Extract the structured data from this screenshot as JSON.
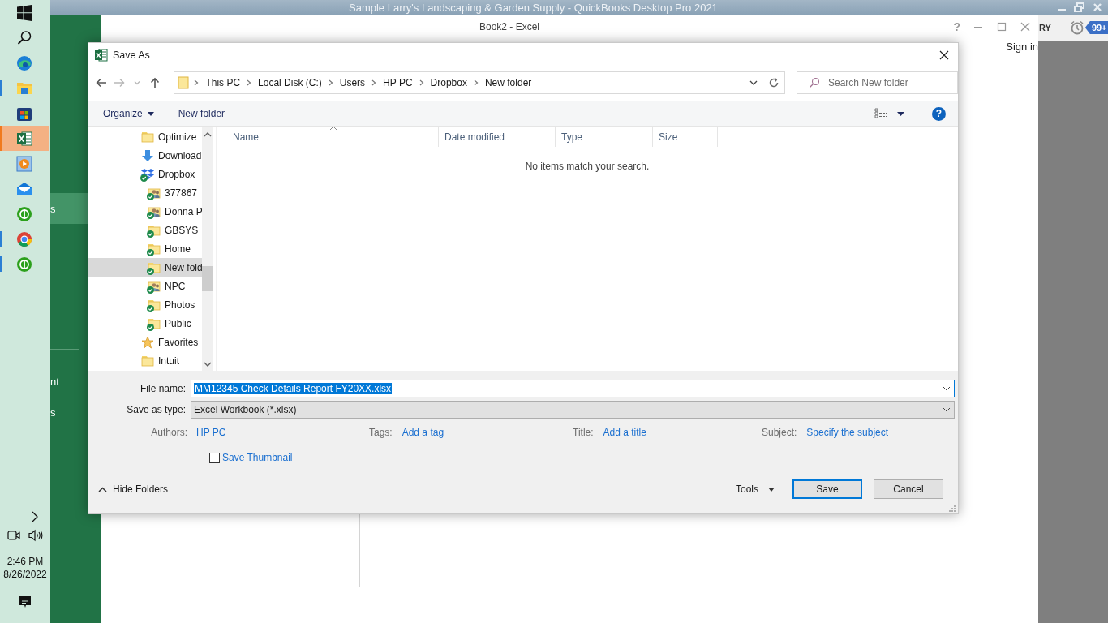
{
  "quickbooks": {
    "title": "Sample Larry's Landscaping & Garden Supply - QuickBooks Desktop Pro 2021",
    "tab_fragment": "RY",
    "reminder_count": "99+"
  },
  "excel": {
    "title": "Book2 - Excel",
    "help": "?",
    "sign_in": "Sign in",
    "backstage_items": [
      {
        "label": "s",
        "selected": true
      },
      {
        "label": "nt",
        "selected": false
      },
      {
        "label": "s",
        "selected": false
      }
    ]
  },
  "dialog": {
    "title": "Save As",
    "address_nav": [
      {
        "disabled": false
      },
      {
        "disabled": true
      },
      {
        "disabled": true
      },
      {
        "disabled": false
      }
    ],
    "breadcrumb": [
      "This PC",
      "Local Disk (C:)",
      "Users",
      "HP PC",
      "Dropbox",
      "New folder"
    ],
    "search": {
      "placeholder": "Search New folder"
    },
    "toolbar": {
      "organize": "Organize",
      "new_folder": "New folder",
      "help": "?"
    },
    "nav": [
      {
        "label": "Optimize",
        "kind": "folder",
        "synced": false,
        "selected": false
      },
      {
        "label": "Download",
        "kind": "download",
        "synced": false,
        "selected": false
      },
      {
        "label": "Dropbox",
        "kind": "dropbox",
        "synced": true,
        "selected": false,
        "children": [
          {
            "label": "377867",
            "kind": "shared",
            "synced": true,
            "selected": false
          },
          {
            "label": "Donna P",
            "kind": "shared",
            "synced": true,
            "selected": false
          },
          {
            "label": "GBSYS",
            "kind": "folder",
            "synced": true,
            "selected": false
          },
          {
            "label": "Home",
            "kind": "folder",
            "synced": true,
            "selected": false
          },
          {
            "label": "New fold",
            "kind": "folder",
            "synced": true,
            "selected": true
          },
          {
            "label": "NPC",
            "kind": "shared",
            "synced": true,
            "selected": false
          },
          {
            "label": "Photos",
            "kind": "folder",
            "synced": true,
            "selected": false
          },
          {
            "label": "Public",
            "kind": "folder",
            "synced": true,
            "selected": false
          }
        ]
      },
      {
        "label": "Favorites",
        "kind": "star",
        "synced": false,
        "selected": false
      },
      {
        "label": "Intuit",
        "kind": "folder",
        "synced": false,
        "selected": false
      }
    ],
    "columns": [
      {
        "label": "Name",
        "sorted": true
      },
      {
        "label": "Date modified",
        "sorted": false
      },
      {
        "label": "Type",
        "sorted": false
      },
      {
        "label": "Size",
        "sorted": false
      }
    ],
    "empty_message": "No items match your search.",
    "file_name": {
      "label": "File name:",
      "value": "MM12345 Check Details Report FY20XX.xlsx",
      "highlighted": true
    },
    "save_type": {
      "label": "Save as type:",
      "value": "Excel Workbook (*.xlsx)"
    },
    "metadata": [
      {
        "label": "Authors:",
        "value": "HP PC"
      },
      {
        "label": "Tags:",
        "value": "Add a tag"
      },
      {
        "label": "Title:",
        "value": "Add a title"
      },
      {
        "label": "Subject:",
        "value": "Specify the subject"
      }
    ],
    "save_thumbnail": {
      "label": "Save Thumbnail",
      "checked": false
    },
    "hide_folders": "Hide Folders",
    "tools": "Tools",
    "buttons": [
      {
        "label": "Save",
        "default": true
      },
      {
        "label": "Cancel",
        "default": false
      }
    ]
  },
  "taskbar": {
    "apps": [
      {
        "selected": false,
        "running": false
      },
      {
        "selected": false,
        "running": false
      },
      {
        "selected": false,
        "running": false
      },
      {
        "selected": false,
        "running": true
      },
      {
        "selected": false,
        "running": false
      },
      {
        "selected": true,
        "running": true
      },
      {
        "selected": false,
        "running": false
      },
      {
        "selected": false,
        "running": false
      },
      {
        "selected": false,
        "running": false
      },
      {
        "selected": false,
        "running": true
      },
      {
        "selected": false,
        "running": true
      }
    ],
    "time": "2:46 PM",
    "date": "8/26/2022"
  }
}
